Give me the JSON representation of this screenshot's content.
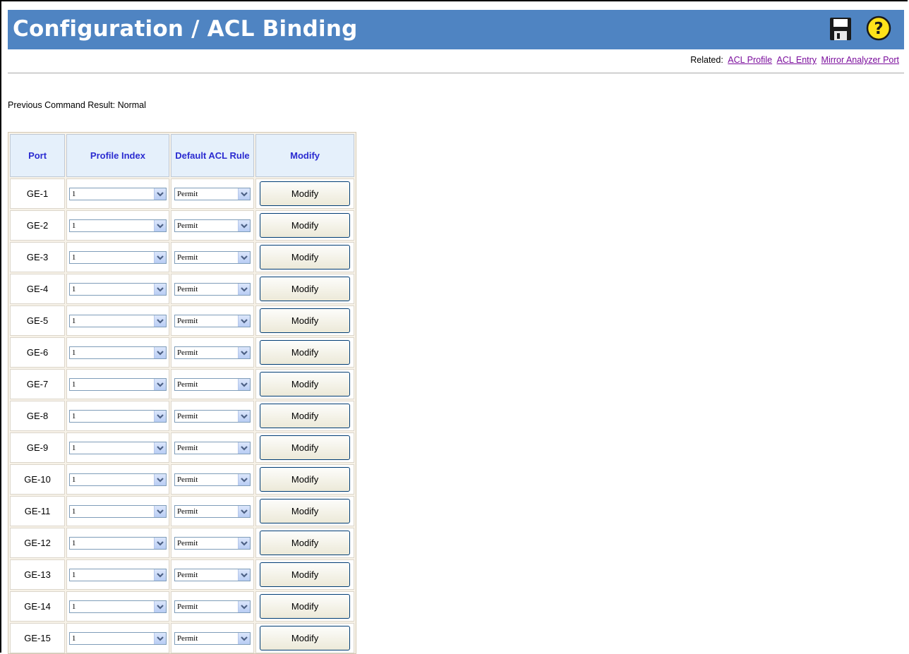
{
  "page": {
    "title": "Configuration / ACL Binding",
    "related_label": "Related:",
    "related_links": [
      "ACL Profile",
      "ACL Entry",
      "Mirror Analyzer Port"
    ],
    "status_text": "Previous Command Result: Normal"
  },
  "icons": {
    "save": "floppy-disk-icon",
    "help": "question-mark-help-icon"
  },
  "colors": {
    "titlebar": "#4f84c2",
    "header_text": "#2b2bd1",
    "link": "#7a0c9c"
  },
  "table": {
    "headers": [
      "Port",
      "Profile Index",
      "Default ACL Rule",
      "Modify"
    ],
    "rows": [
      {
        "port": "GE-1",
        "profile_index": "1",
        "default_rule": "Permit",
        "action": "Modify"
      },
      {
        "port": "GE-2",
        "profile_index": "1",
        "default_rule": "Permit",
        "action": "Modify"
      },
      {
        "port": "GE-3",
        "profile_index": "1",
        "default_rule": "Permit",
        "action": "Modify"
      },
      {
        "port": "GE-4",
        "profile_index": "1",
        "default_rule": "Permit",
        "action": "Modify"
      },
      {
        "port": "GE-5",
        "profile_index": "1",
        "default_rule": "Permit",
        "action": "Modify"
      },
      {
        "port": "GE-6",
        "profile_index": "1",
        "default_rule": "Permit",
        "action": "Modify"
      },
      {
        "port": "GE-7",
        "profile_index": "1",
        "default_rule": "Permit",
        "action": "Modify"
      },
      {
        "port": "GE-8",
        "profile_index": "1",
        "default_rule": "Permit",
        "action": "Modify"
      },
      {
        "port": "GE-9",
        "profile_index": "1",
        "default_rule": "Permit",
        "action": "Modify"
      },
      {
        "port": "GE-10",
        "profile_index": "1",
        "default_rule": "Permit",
        "action": "Modify"
      },
      {
        "port": "GE-11",
        "profile_index": "1",
        "default_rule": "Permit",
        "action": "Modify"
      },
      {
        "port": "GE-12",
        "profile_index": "1",
        "default_rule": "Permit",
        "action": "Modify"
      },
      {
        "port": "GE-13",
        "profile_index": "1",
        "default_rule": "Permit",
        "action": "Modify"
      },
      {
        "port": "GE-14",
        "profile_index": "1",
        "default_rule": "Permit",
        "action": "Modify"
      },
      {
        "port": "GE-15",
        "profile_index": "1",
        "default_rule": "Permit",
        "action": "Modify"
      }
    ]
  }
}
